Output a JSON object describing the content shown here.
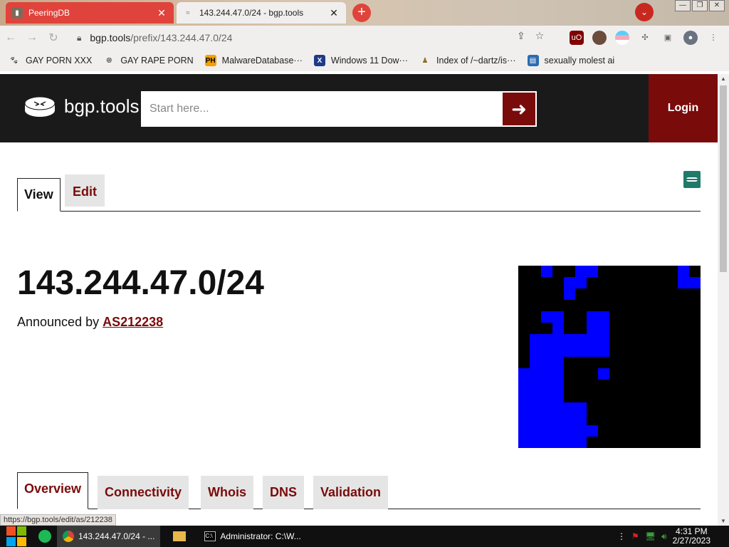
{
  "browser": {
    "tabs": [
      {
        "title": "PeeringDB",
        "close": "✕"
      },
      {
        "title": "143.244.47.0/24 - bgp.tools",
        "close": "✕"
      }
    ],
    "new_tab": "+",
    "url_host": "bgp.tools",
    "url_path": "/prefix/143.244.47.0/24",
    "bookmarks": [
      {
        "label": "GAY PORN XXX",
        "icon": "paw-icon"
      },
      {
        "label": "GAY RAPE PORN",
        "icon": "globe-icon"
      },
      {
        "label": "MalwareDatabase···",
        "icon": "ph-icon",
        "icon_text": "PH"
      },
      {
        "label": "Windows 11 Dow···",
        "icon": "x-icon",
        "icon_text": "X"
      },
      {
        "label": "Index of /~dartz/is···",
        "icon": "person-icon"
      },
      {
        "label": "sexually molest ai",
        "icon": "doc-icon"
      }
    ]
  },
  "site": {
    "logo_text": "bgp.tools",
    "search_placeholder": "Start here...",
    "login_label": "Login",
    "view_tab": "View",
    "edit_tab": "Edit",
    "prefix": "143.244.47.0/24",
    "announced_prefix": "Announced by ",
    "asn": "AS212238",
    "section_tabs": [
      "Overview",
      "Connectivity",
      "Whois",
      "DNS",
      "Validation"
    ],
    "active_section": "Overview",
    "colors": {
      "brand_dark": "#1a1a1a",
      "accent": "#7a0b0b",
      "map_fill": "#0000ff"
    }
  },
  "hilbert_cells": [
    [
      2,
      0
    ],
    [
      5,
      0
    ],
    [
      6,
      0
    ],
    [
      14,
      0
    ],
    [
      4,
      1
    ],
    [
      5,
      1
    ],
    [
      14,
      1
    ],
    [
      15,
      1
    ],
    [
      4,
      2
    ],
    [
      2,
      4
    ],
    [
      3,
      4
    ],
    [
      6,
      4
    ],
    [
      7,
      4
    ],
    [
      3,
      5
    ],
    [
      6,
      5
    ],
    [
      7,
      5
    ],
    [
      1,
      6
    ],
    [
      2,
      6
    ],
    [
      3,
      6
    ],
    [
      4,
      6
    ],
    [
      5,
      6
    ],
    [
      6,
      6
    ],
    [
      7,
      6
    ],
    [
      1,
      7
    ],
    [
      2,
      7
    ],
    [
      3,
      7
    ],
    [
      4,
      7
    ],
    [
      5,
      7
    ],
    [
      6,
      7
    ],
    [
      7,
      7
    ],
    [
      1,
      8
    ],
    [
      2,
      8
    ],
    [
      3,
      8
    ],
    [
      0,
      9
    ],
    [
      1,
      9
    ],
    [
      2,
      9
    ],
    [
      3,
      9
    ],
    [
      7,
      9
    ],
    [
      0,
      10
    ],
    [
      1,
      10
    ],
    [
      2,
      10
    ],
    [
      3,
      10
    ],
    [
      0,
      11
    ],
    [
      1,
      11
    ],
    [
      2,
      11
    ],
    [
      3,
      11
    ],
    [
      0,
      12
    ],
    [
      1,
      12
    ],
    [
      2,
      12
    ],
    [
      3,
      12
    ],
    [
      4,
      12
    ],
    [
      5,
      12
    ],
    [
      0,
      13
    ],
    [
      1,
      13
    ],
    [
      2,
      13
    ],
    [
      3,
      13
    ],
    [
      4,
      13
    ],
    [
      5,
      13
    ],
    [
      0,
      14
    ],
    [
      1,
      14
    ],
    [
      2,
      14
    ],
    [
      3,
      14
    ],
    [
      4,
      14
    ],
    [
      5,
      14
    ],
    [
      6,
      14
    ],
    [
      0,
      15
    ],
    [
      1,
      15
    ],
    [
      2,
      15
    ],
    [
      3,
      15
    ],
    [
      4,
      15
    ],
    [
      5,
      15
    ]
  ],
  "status_url": "https://bgp.tools/edit/as/212238",
  "taskbar": {
    "items": [
      "143.244.47.0/24 - ...",
      "Administrator: C:\\W..."
    ],
    "time": "4:31 PM",
    "date": "2/27/2023"
  }
}
